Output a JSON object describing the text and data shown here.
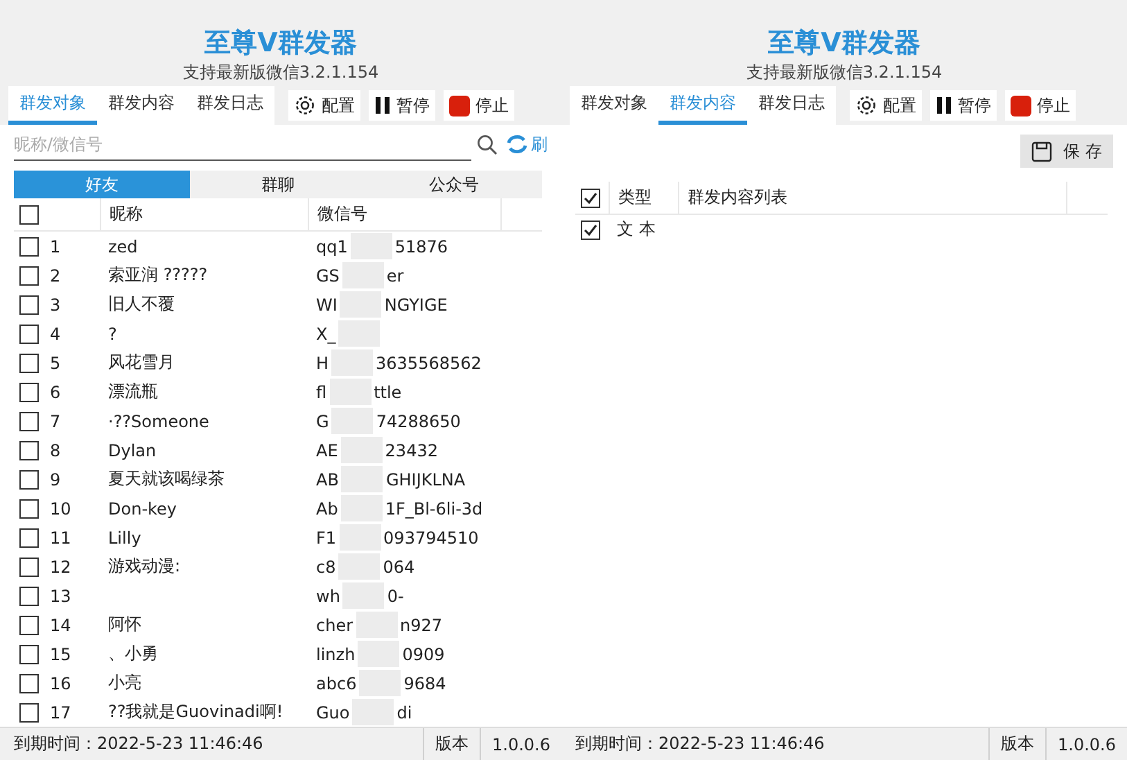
{
  "windows": [
    {
      "title": "至尊V群发器",
      "subtitle": "支持最新版微信3.2.1.154",
      "tabs": [
        {
          "label": "群发对象",
          "selected": true
        },
        {
          "label": "群发内容",
          "selected": false
        },
        {
          "label": "群发日志",
          "selected": false
        }
      ],
      "tools": [
        {
          "kind": "config",
          "label": "配置"
        },
        {
          "kind": "pause",
          "label": "暂停"
        },
        {
          "kind": "stop",
          "label": "停止"
        }
      ],
      "panel": {
        "kind": "contacts",
        "search_placeholder": "昵称/微信号",
        "refresh_label": "刷",
        "segments": [
          {
            "label": "好友",
            "selected": true
          },
          {
            "label": "群聊",
            "selected": false
          },
          {
            "label": "公众号",
            "selected": false
          }
        ],
        "all_checked": false,
        "columns": [
          "昵称",
          "微信号"
        ],
        "rows": [
          {
            "checked": false,
            "index": "1",
            "nickname": "zed",
            "wechat_visible": [
              "qq1",
              "51876"
            ]
          },
          {
            "checked": false,
            "index": "2",
            "nickname": "索亚润 ?????",
            "wechat_visible": [
              "GS",
              "er"
            ]
          },
          {
            "checked": false,
            "index": "3",
            "nickname": "旧人不覆",
            "wechat_visible": [
              "WI",
              "NGYIGE"
            ]
          },
          {
            "checked": false,
            "index": "4",
            "nickname": "?",
            "wechat_visible": [
              "X_"
            ]
          },
          {
            "checked": false,
            "index": "5",
            "nickname": "风花雪月",
            "wechat_visible": [
              "H",
              "3635568562"
            ]
          },
          {
            "checked": false,
            "index": "6",
            "nickname": "漂流瓶",
            "wechat_visible": [
              "fl",
              "ttle"
            ]
          },
          {
            "checked": false,
            "index": "7",
            "nickname": "·??Someone",
            "wechat_visible": [
              "G",
              "74288650"
            ]
          },
          {
            "checked": false,
            "index": "8",
            "nickname": "Dylan",
            "wechat_visible": [
              "AE",
              "23432"
            ]
          },
          {
            "checked": false,
            "index": "9",
            "nickname": "夏天就该喝绿茶",
            "wechat_visible": [
              "AB",
              "GHIJKLNA"
            ]
          },
          {
            "checked": false,
            "index": "10",
            "nickname": "Don-key",
            "wechat_visible": [
              "Ab",
              "1F_Bl-6li-3d"
            ]
          },
          {
            "checked": false,
            "index": "11",
            "nickname": "Lilly",
            "wechat_visible": [
              "F1",
              "093794510"
            ]
          },
          {
            "checked": false,
            "index": "12",
            "nickname": "游戏动漫:",
            "wechat_visible": [
              "c8",
              "064"
            ]
          },
          {
            "checked": false,
            "index": "13",
            "wechat_visible": [
              "wh",
              "0-"
            ]
          },
          {
            "checked": false,
            "index": "14",
            "nickname": "阿怀",
            "wechat_visible": [
              "cher",
              "n927"
            ]
          },
          {
            "checked": false,
            "index": "15",
            "nickname": "、小勇",
            "wechat_visible": [
              "linzh",
              "0909"
            ]
          },
          {
            "checked": false,
            "index": "16",
            "nickname": "小亮",
            "wechat_visible": [
              "abc6",
              "9684"
            ]
          },
          {
            "checked": false,
            "index": "17",
            "nickname": "??我就是Guovinadi啊!",
            "wechat_visible": [
              "Guo",
              "di"
            ]
          }
        ]
      },
      "status_bar": {
        "expiry": "到期时间：2022-5-23 11:46:46",
        "version_label": "版本",
        "version": "1.0.0.6"
      }
    },
    {
      "title": "至尊V群发器",
      "subtitle": "支持最新版微信3.2.1.154",
      "tabs": [
        {
          "label": "群发对象",
          "selected": false
        },
        {
          "label": "群发内容",
          "selected": true
        },
        {
          "label": "群发日志",
          "selected": false
        }
      ],
      "tools": [
        {
          "kind": "config",
          "label": "配置"
        },
        {
          "kind": "pause",
          "label": "暂停"
        },
        {
          "kind": "stop",
          "label": "停止"
        }
      ],
      "panel": {
        "kind": "content",
        "save_label": "保 存",
        "all_checked": true,
        "columns": [
          "类型",
          "群发内容列表"
        ],
        "rows": [
          {
            "checked": true,
            "type": "文 本"
          }
        ]
      },
      "status_bar": {
        "expiry": "到期时间：2022-5-23 11:46:46",
        "version_label": "版本",
        "version": "1.0.0.6"
      }
    }
  ]
}
